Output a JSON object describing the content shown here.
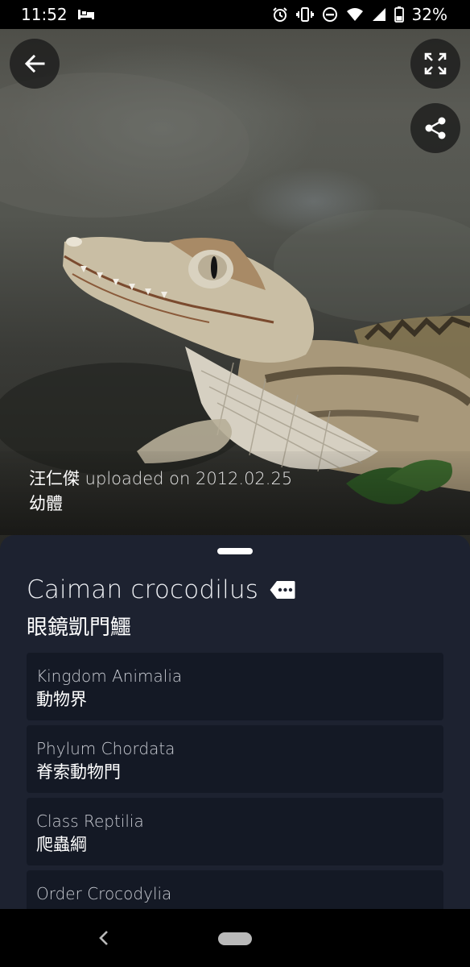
{
  "status_bar": {
    "time": "11:52",
    "battery": "32%",
    "icons": [
      "sleep-icon",
      "alarm-icon",
      "vibrate-icon",
      "do-not-disturb-icon",
      "wifi-icon",
      "cellular-signal-icon",
      "battery-icon"
    ]
  },
  "photo": {
    "subject_icon": "caiman-photo",
    "actions": [
      "back-arrow-icon",
      "fullscreen-icon",
      "share-icon"
    ]
  },
  "caption": {
    "author": "汪仁傑",
    "uploaded_text": " uploaded on 2012.02.25",
    "life_stage": "幼體"
  },
  "species": {
    "scientific_name": "Caiman crocodilus",
    "common_name": "眼鏡凱門鱷",
    "tag_icon": "more-tag-icon"
  },
  "taxonomy": [
    {
      "rank": "Kingdom Animalia",
      "zh": "動物界"
    },
    {
      "rank": "Phylum Chordata",
      "zh": "脊索動物門"
    },
    {
      "rank": "Class Reptilia",
      "zh": "爬蟲綱"
    },
    {
      "rank": "Order Crocodylia",
      "zh": ""
    }
  ],
  "colors": {
    "sheet_background": "#1d2230",
    "card_background": "#141925",
    "text_primary": "#ffffff"
  }
}
